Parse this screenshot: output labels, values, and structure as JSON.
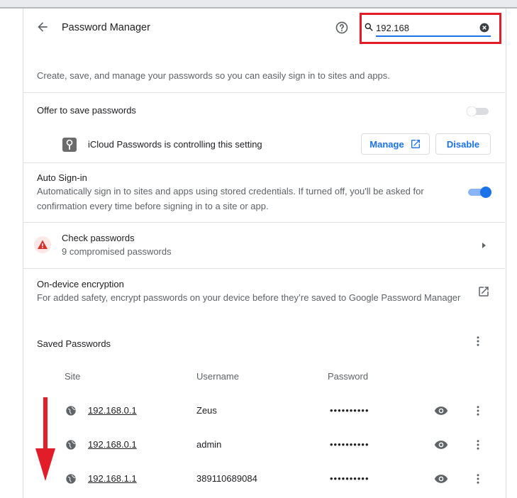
{
  "header": {
    "title": "Password Manager",
    "search_value": "192.168"
  },
  "description": "Create, save, and manage your passwords so you can easily sign in to sites and apps.",
  "offer_save": {
    "label": "Offer to save passwords",
    "enabled": false,
    "managed_text": "iCloud Passwords is controlling this setting",
    "manage_label": "Manage",
    "disable_label": "Disable"
  },
  "auto_signin": {
    "label": "Auto Sign-in",
    "sub_line1": "Automatically sign in to sites and apps using stored credentials. If turned off, you'll be asked for",
    "sub_line2": "confirmation every time before signing in to a site or app.",
    "enabled": true
  },
  "check": {
    "label": "Check passwords",
    "sub": "9 compromised passwords"
  },
  "encryption": {
    "label": "On-device encryption",
    "sub": "For added safety, encrypt passwords on your device before they’re saved to Google Password Manager"
  },
  "saved": {
    "title": "Saved Passwords",
    "columns": {
      "site": "Site",
      "username": "Username",
      "password": "Password"
    },
    "rows": [
      {
        "site": "192.168.0.1",
        "username": "Zeus",
        "password": "••••••••••"
      },
      {
        "site": "192.168.0.1",
        "username": "admin",
        "password": "••••••••••"
      },
      {
        "site": "192.168.1.1",
        "username": "389110689084",
        "password": "••••••••••"
      }
    ]
  },
  "colors": {
    "accent": "#1a73e8",
    "highlight": "#e11d2a",
    "warning": "#d93025"
  },
  "icons": [
    "back-arrow-icon",
    "help-icon",
    "search-icon",
    "clear-icon",
    "key-icon",
    "external-link-icon",
    "warning-icon",
    "chevron-right-icon",
    "kebab-menu-icon",
    "globe-icon",
    "eye-icon",
    "down-arrow-icon"
  ]
}
